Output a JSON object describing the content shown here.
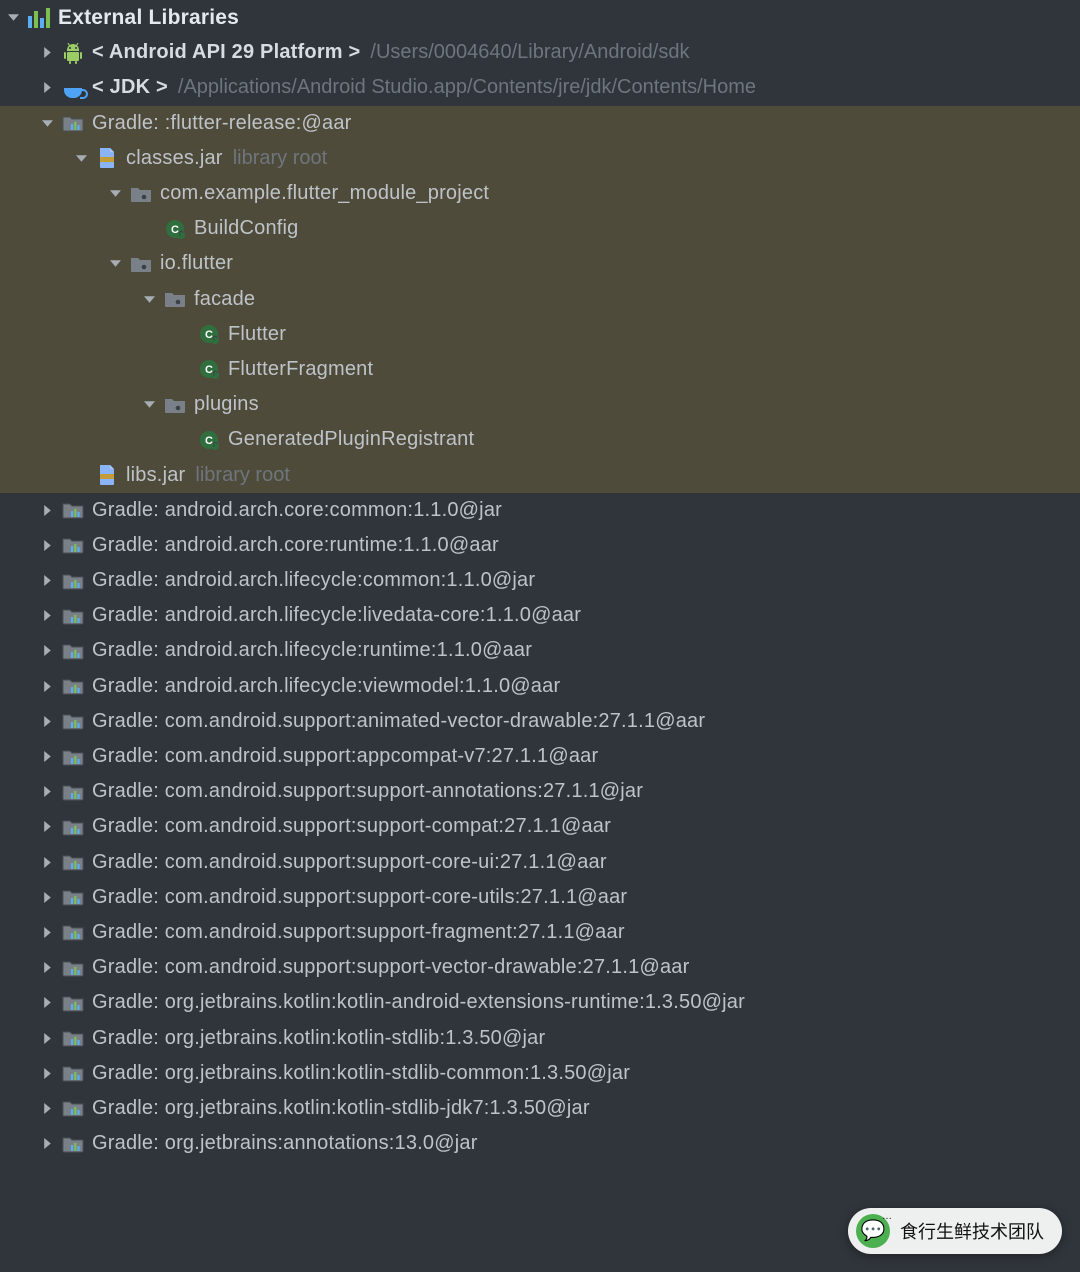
{
  "rootLabel": "External Libraries",
  "libraryRoot": "library root",
  "rows": [
    {
      "id": "root",
      "depth": 0,
      "arrow": "down",
      "icon": "externlib",
      "parts": [
        {
          "t": "External Libraries",
          "cls": "strong"
        }
      ],
      "hl": false,
      "rootRow": true
    },
    {
      "id": "android-api",
      "depth": 1,
      "arrow": "right",
      "icon": "android",
      "parts": [
        {
          "t": "< Android API 29 Platform >",
          "cls": "strong"
        },
        {
          "t": "/Users/0004640/Library/Android/sdk",
          "cls": "muted"
        }
      ],
      "hl": false
    },
    {
      "id": "jdk",
      "depth": 1,
      "arrow": "right",
      "icon": "jdk",
      "parts": [
        {
          "t": "< JDK >",
          "cls": "strong"
        },
        {
          "t": "/Applications/Android Studio.app/Contents/jre/jdk/Contents/Home",
          "cls": "muted"
        }
      ],
      "hl": false
    },
    {
      "id": "gradle-flutter-release",
      "depth": 1,
      "arrow": "down",
      "icon": "extfolder",
      "parts": [
        {
          "t": "Gradle: :flutter-release:@aar",
          "cls": ""
        }
      ],
      "hl": true
    },
    {
      "id": "classes-jar",
      "depth": 2,
      "arrow": "down",
      "icon": "jar",
      "parts": [
        {
          "t": "classes.jar",
          "cls": ""
        },
        {
          "t": "library root",
          "cls": "muted"
        }
      ],
      "hl": true
    },
    {
      "id": "pkg-example",
      "depth": 3,
      "arrow": "down",
      "icon": "pkg",
      "parts": [
        {
          "t": "com.example.flutter_module_project",
          "cls": ""
        }
      ],
      "hl": true
    },
    {
      "id": "class-buildconfig",
      "depth": 4,
      "arrow": "none",
      "icon": "class",
      "parts": [
        {
          "t": "BuildConfig",
          "cls": ""
        }
      ],
      "hl": true
    },
    {
      "id": "pkg-ioflutter",
      "depth": 3,
      "arrow": "down",
      "icon": "pkg",
      "parts": [
        {
          "t": "io.flutter",
          "cls": ""
        }
      ],
      "hl": true
    },
    {
      "id": "pkg-facade",
      "depth": 4,
      "arrow": "down",
      "icon": "pkg",
      "parts": [
        {
          "t": "facade",
          "cls": ""
        }
      ],
      "hl": true
    },
    {
      "id": "class-flutter",
      "depth": 5,
      "arrow": "none",
      "icon": "class",
      "parts": [
        {
          "t": "Flutter",
          "cls": ""
        }
      ],
      "hl": true
    },
    {
      "id": "class-flutterfragment",
      "depth": 5,
      "arrow": "none",
      "icon": "class",
      "parts": [
        {
          "t": "FlutterFragment",
          "cls": ""
        }
      ],
      "hl": true
    },
    {
      "id": "pkg-plugins",
      "depth": 4,
      "arrow": "down",
      "icon": "pkg",
      "parts": [
        {
          "t": "plugins",
          "cls": ""
        }
      ],
      "hl": true
    },
    {
      "id": "class-genplugin",
      "depth": 5,
      "arrow": "none",
      "icon": "class",
      "parts": [
        {
          "t": "GeneratedPluginRegistrant",
          "cls": ""
        }
      ],
      "hl": true
    },
    {
      "id": "libs-jar",
      "depth": 2,
      "arrow": "none",
      "icon": "jar",
      "parts": [
        {
          "t": "libs.jar",
          "cls": ""
        },
        {
          "t": "library root",
          "cls": "muted"
        }
      ],
      "hl": true
    },
    {
      "id": "g-arch-core-common",
      "depth": 1,
      "arrow": "right",
      "icon": "extfolder",
      "parts": [
        {
          "t": "Gradle: android.arch.core:common:1.1.0@jar",
          "cls": ""
        }
      ],
      "hl": false
    },
    {
      "id": "g-arch-core-runtime",
      "depth": 1,
      "arrow": "right",
      "icon": "extfolder",
      "parts": [
        {
          "t": "Gradle: android.arch.core:runtime:1.1.0@aar",
          "cls": ""
        }
      ],
      "hl": false
    },
    {
      "id": "g-arch-life-common",
      "depth": 1,
      "arrow": "right",
      "icon": "extfolder",
      "parts": [
        {
          "t": "Gradle: android.arch.lifecycle:common:1.1.0@jar",
          "cls": ""
        }
      ],
      "hl": false
    },
    {
      "id": "g-arch-life-livedata",
      "depth": 1,
      "arrow": "right",
      "icon": "extfolder",
      "parts": [
        {
          "t": "Gradle: android.arch.lifecycle:livedata-core:1.1.0@aar",
          "cls": ""
        }
      ],
      "hl": false
    },
    {
      "id": "g-arch-life-runtime",
      "depth": 1,
      "arrow": "right",
      "icon": "extfolder",
      "parts": [
        {
          "t": "Gradle: android.arch.lifecycle:runtime:1.1.0@aar",
          "cls": ""
        }
      ],
      "hl": false
    },
    {
      "id": "g-arch-life-viewmodel",
      "depth": 1,
      "arrow": "right",
      "icon": "extfolder",
      "parts": [
        {
          "t": "Gradle: android.arch.lifecycle:viewmodel:1.1.0@aar",
          "cls": ""
        }
      ],
      "hl": false
    },
    {
      "id": "g-sup-animvec",
      "depth": 1,
      "arrow": "right",
      "icon": "extfolder",
      "parts": [
        {
          "t": "Gradle: com.android.support:animated-vector-drawable:27.1.1@aar",
          "cls": ""
        }
      ],
      "hl": false
    },
    {
      "id": "g-sup-appcompat",
      "depth": 1,
      "arrow": "right",
      "icon": "extfolder",
      "parts": [
        {
          "t": "Gradle: com.android.support:appcompat-v7:27.1.1@aar",
          "cls": ""
        }
      ],
      "hl": false
    },
    {
      "id": "g-sup-annot",
      "depth": 1,
      "arrow": "right",
      "icon": "extfolder",
      "parts": [
        {
          "t": "Gradle: com.android.support:support-annotations:27.1.1@jar",
          "cls": ""
        }
      ],
      "hl": false
    },
    {
      "id": "g-sup-compat",
      "depth": 1,
      "arrow": "right",
      "icon": "extfolder",
      "parts": [
        {
          "t": "Gradle: com.android.support:support-compat:27.1.1@aar",
          "cls": ""
        }
      ],
      "hl": false
    },
    {
      "id": "g-sup-coreui",
      "depth": 1,
      "arrow": "right",
      "icon": "extfolder",
      "parts": [
        {
          "t": "Gradle: com.android.support:support-core-ui:27.1.1@aar",
          "cls": ""
        }
      ],
      "hl": false
    },
    {
      "id": "g-sup-coreutils",
      "depth": 1,
      "arrow": "right",
      "icon": "extfolder",
      "parts": [
        {
          "t": "Gradle: com.android.support:support-core-utils:27.1.1@aar",
          "cls": ""
        }
      ],
      "hl": false
    },
    {
      "id": "g-sup-fragment",
      "depth": 1,
      "arrow": "right",
      "icon": "extfolder",
      "parts": [
        {
          "t": "Gradle: com.android.support:support-fragment:27.1.1@aar",
          "cls": ""
        }
      ],
      "hl": false
    },
    {
      "id": "g-sup-vecdraw",
      "depth": 1,
      "arrow": "right",
      "icon": "extfolder",
      "parts": [
        {
          "t": "Gradle: com.android.support:support-vector-drawable:27.1.1@aar",
          "cls": ""
        }
      ],
      "hl": false
    },
    {
      "id": "g-kotlin-ext",
      "depth": 1,
      "arrow": "right",
      "icon": "extfolder",
      "parts": [
        {
          "t": "Gradle: org.jetbrains.kotlin:kotlin-android-extensions-runtime:1.3.50@jar",
          "cls": ""
        }
      ],
      "hl": false
    },
    {
      "id": "g-kotlin-stdlib",
      "depth": 1,
      "arrow": "right",
      "icon": "extfolder",
      "parts": [
        {
          "t": "Gradle: org.jetbrains.kotlin:kotlin-stdlib:1.3.50@jar",
          "cls": ""
        }
      ],
      "hl": false
    },
    {
      "id": "g-kotlin-stdlib-common",
      "depth": 1,
      "arrow": "right",
      "icon": "extfolder",
      "parts": [
        {
          "t": "Gradle: org.jetbrains.kotlin:kotlin-stdlib-common:1.3.50@jar",
          "cls": ""
        }
      ],
      "hl": false
    },
    {
      "id": "g-kotlin-stdlib-jdk7",
      "depth": 1,
      "arrow": "right",
      "icon": "extfolder",
      "parts": [
        {
          "t": "Gradle: org.jetbrains.kotlin:kotlin-stdlib-jdk7:1.3.50@jar",
          "cls": ""
        }
      ],
      "hl": false
    },
    {
      "id": "g-jetbrains-annot",
      "depth": 1,
      "arrow": "right",
      "icon": "extfolder",
      "parts": [
        {
          "t": "Gradle: org.jetbrains:annotations:13.0@jar",
          "cls": ""
        }
      ],
      "hl": false
    }
  ],
  "watermark": "食行生鲜技术团队"
}
